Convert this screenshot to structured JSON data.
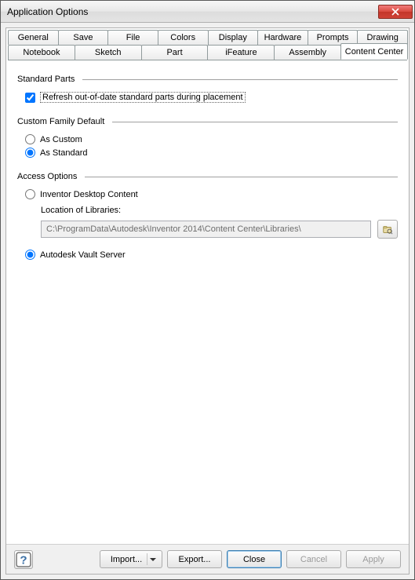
{
  "window": {
    "title": "Application Options"
  },
  "tabs": {
    "row1": [
      "General",
      "Save",
      "File",
      "Colors",
      "Display",
      "Hardware",
      "Prompts",
      "Drawing"
    ],
    "row2": [
      "Notebook",
      "Sketch",
      "Part",
      "iFeature",
      "Assembly",
      "Content Center"
    ],
    "active": "Content Center"
  },
  "sections": {
    "standard_parts": {
      "title": "Standard Parts",
      "refresh_label": "Refresh out-of-date standard parts during placement",
      "refresh_checked": true
    },
    "custom_family": {
      "title": "Custom Family Default",
      "as_custom": "As Custom",
      "as_standard": "As Standard",
      "selected": "standard"
    },
    "access": {
      "title": "Access Options",
      "desktop_label": "Inventor Desktop Content",
      "location_label": "Location of Libraries:",
      "location_value": "C:\\ProgramData\\Autodesk\\Inventor 2014\\Content Center\\Libraries\\",
      "vault_label": "Autodesk Vault Server",
      "selected": "vault"
    }
  },
  "footer": {
    "import": "Import...",
    "export": "Export...",
    "close": "Close",
    "cancel": "Cancel",
    "apply": "Apply"
  }
}
